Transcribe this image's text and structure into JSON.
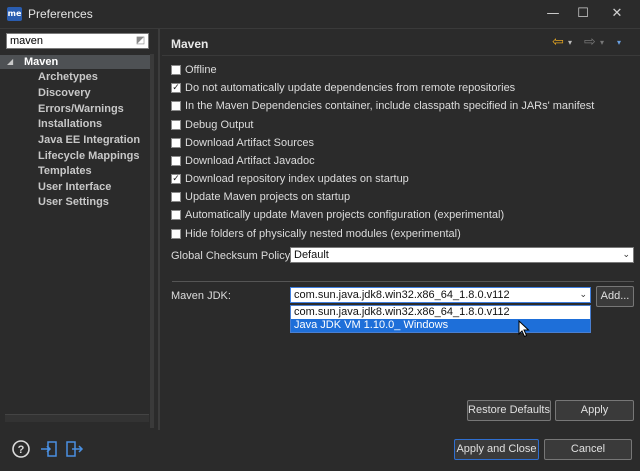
{
  "window": {
    "app_icon_text": "me",
    "title": "Preferences",
    "minimize_glyph": "—",
    "maximize_glyph": "☐",
    "close_glyph": "✕"
  },
  "filter": {
    "value": "maven",
    "clear_icon": "clear-icon"
  },
  "tree": {
    "root": {
      "arrow": "◢",
      "label": "Maven"
    },
    "items": [
      {
        "label": "Archetypes"
      },
      {
        "label": "Discovery"
      },
      {
        "label": "Errors/Warnings"
      },
      {
        "label": "Installations"
      },
      {
        "label": "Java EE Integration"
      },
      {
        "label": "Lifecycle Mappings"
      },
      {
        "label": "Templates"
      },
      {
        "label": "User Interface"
      },
      {
        "label": "User Settings"
      }
    ]
  },
  "panel": {
    "title": "Maven",
    "nav": {
      "back": "⇦",
      "back_dd": "▾",
      "forward": "⇨",
      "forward_dd": "▾",
      "menu": "▾"
    }
  },
  "options": [
    {
      "label": "Offline",
      "checked": false
    },
    {
      "label": "Do not automatically update dependencies from remote repositories",
      "checked": true
    },
    {
      "label": "In the Maven Dependencies container, include classpath specified in JARs' manifest",
      "checked": false
    },
    {
      "label": "Debug Output",
      "checked": false
    },
    {
      "label": "Download Artifact Sources",
      "checked": false
    },
    {
      "label": "Download Artifact Javadoc",
      "checked": false
    },
    {
      "label": "Download repository index updates on startup",
      "checked": true
    },
    {
      "label": "Update Maven projects on startup",
      "checked": false
    },
    {
      "label": "Automatically update Maven projects configuration (experimental)",
      "checked": false
    },
    {
      "label": "Hide folders of physically nested modules (experimental)",
      "checked": false
    }
  ],
  "checksum": {
    "label": "Global Checksum Policy:",
    "value": "Default"
  },
  "jdk": {
    "label": "Maven JDK:",
    "value": "com.sun.java.jdk8.win32.x86_64_1.8.0.v112",
    "add_button": "Add...",
    "options": [
      {
        "label": "com.sun.java.jdk8.win32.x86_64_1.8.0.v112",
        "selected": false
      },
      {
        "label": "Java JDK VM 1.10.0_ Windows",
        "selected": true
      }
    ]
  },
  "buttons": {
    "restore_defaults": "Restore Defaults",
    "apply": "Apply",
    "apply_and_close": "Apply and Close",
    "cancel": "Cancel"
  },
  "bottom_icons": [
    "help-icon",
    "import-icon",
    "export-icon"
  ],
  "colors": {
    "background": "#2b2b2b",
    "selection": "#1e6fd9",
    "accent_arrow": "#e5a622"
  }
}
